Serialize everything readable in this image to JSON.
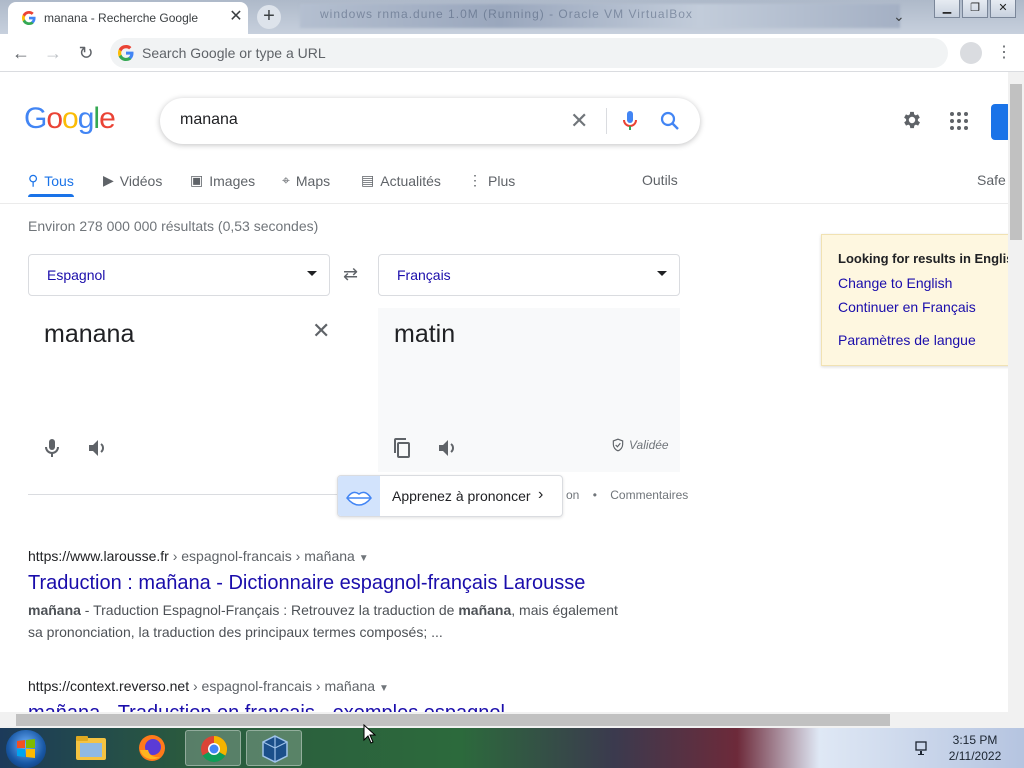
{
  "browser": {
    "tab_title": "manana - Recherche Google",
    "blurred_tab_text": "windows rnma.dune 1.0M (Running) - Oracle VM VirtualBox",
    "omnibox_placeholder": "Search Google or type a URL"
  },
  "google": {
    "logo": "Google",
    "query": "manana",
    "tabs": [
      "Tous",
      "Vidéos",
      "Images",
      "Maps",
      "Actualités",
      "Plus"
    ],
    "tools": "Outils",
    "safe": "Safe",
    "stats": "Environ 278 000 000 résultats (0,53 secondes)"
  },
  "translate": {
    "source_lang": "Espagnol",
    "target_lang": "Français",
    "source_text": "manana",
    "target_text": "matin",
    "validated": "Validée",
    "learn_label": "Apprenez à prononcer",
    "partial_link": "on",
    "feedback": "Commentaires"
  },
  "notice": {
    "heading": "Looking for results in English?",
    "link1": "Change to English",
    "link2": "Continuer en Français",
    "link3": "Paramètres de langue"
  },
  "results": [
    {
      "url_host": "https://www.larousse.fr",
      "url_path": " › espagnol-francais › mañana",
      "title": "Traduction : mañana - Dictionnaire espagnol-français Larousse",
      "desc_bold1": "mañana",
      "desc_1": " - Traduction Espagnol-Français : Retrouvez la traduction de ",
      "desc_bold2": "mañana",
      "desc_2": ", mais également sa prononciation, la traduction des principaux termes composés; ..."
    },
    {
      "url_host": "https://context.reverso.net",
      "url_path": " › espagnol-francais › mañana",
      "title": "mañana - Traduction en français - exemples espagnol"
    }
  ],
  "taskbar": {
    "time": "3:15 PM",
    "date": "2/11/2022"
  }
}
